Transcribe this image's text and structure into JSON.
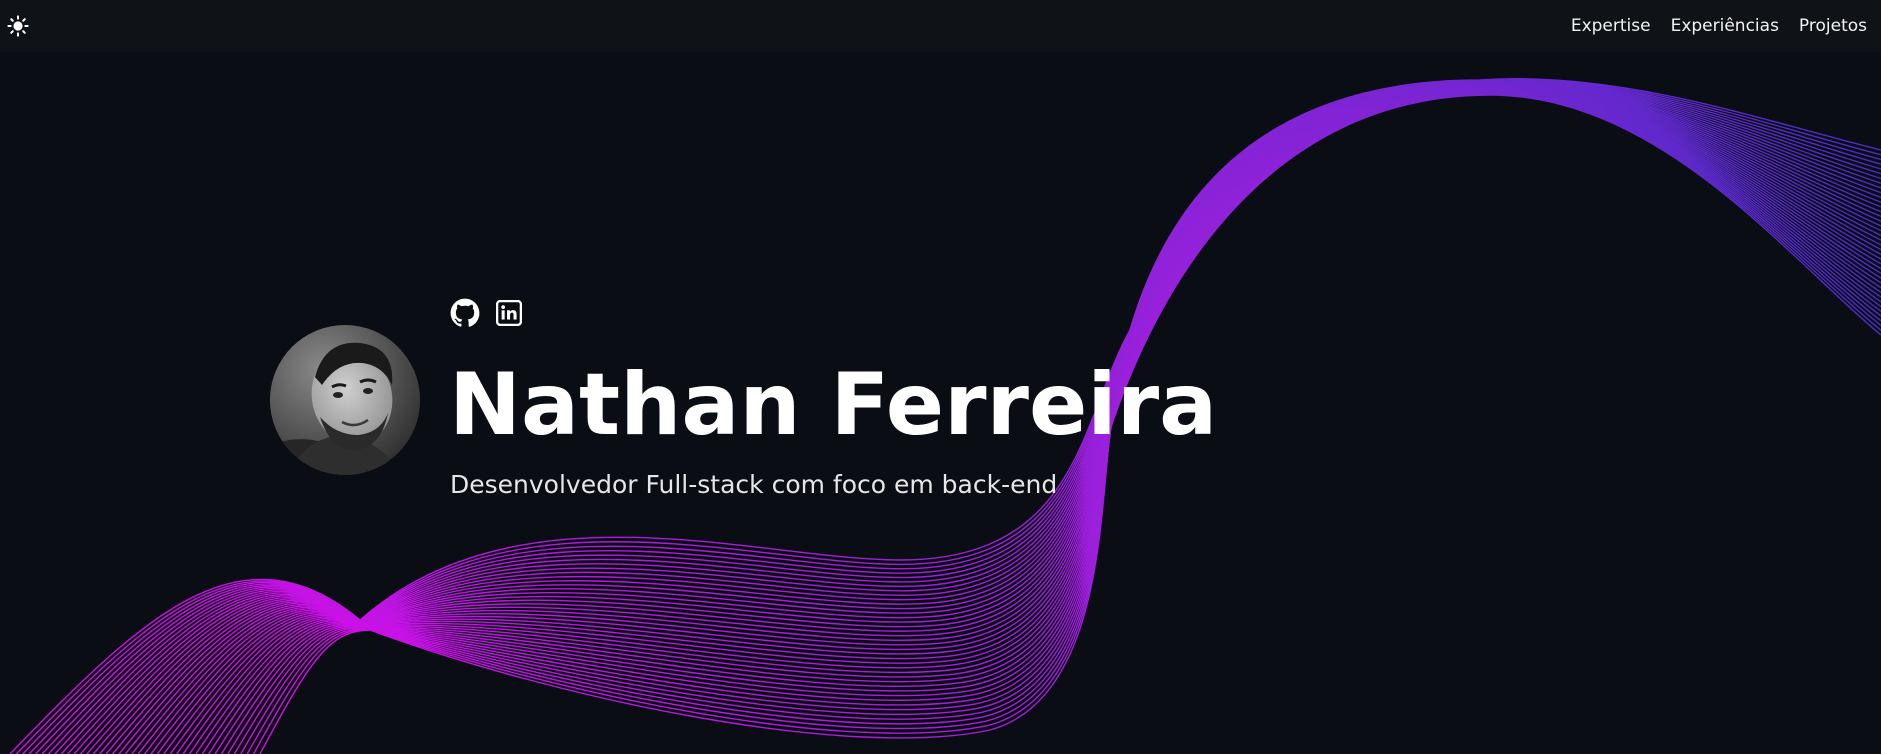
{
  "nav": {
    "theme_toggle_icon": "sun-icon",
    "links": [
      "Expertise",
      "Experiências",
      "Projetos"
    ]
  },
  "hero": {
    "name": "Nathan Ferreira",
    "role": "Desenvolvedor Full-stack com foco em back-end",
    "socials": [
      "github-icon",
      "linkedin-icon"
    ],
    "avatar": "profile-photo"
  },
  "colors": {
    "background": "#0a0d13",
    "navbar": "#0f1217",
    "wave_start": "#d20ee8",
    "wave_mid": "#8a24d6",
    "wave_end": "#4b2cc8",
    "text": "#ffffff"
  }
}
